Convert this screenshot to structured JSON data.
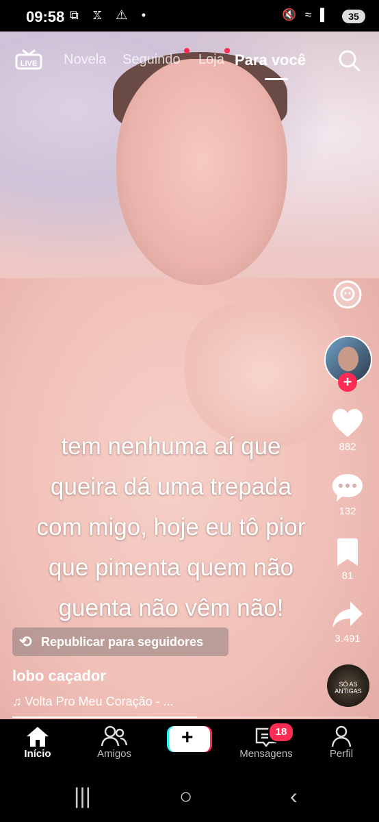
{
  "status_bar": {
    "time": "09:58",
    "left_icons": "⧉ 𝕏 ⚠ •",
    "right_icons": "🔇 ≈ ▌",
    "battery": "35"
  },
  "top_nav": {
    "live_label": "LIVE",
    "tabs": [
      {
        "label": "Novela"
      },
      {
        "label": "Seguindo"
      },
      {
        "label": "Loja"
      },
      {
        "label": "Para você"
      }
    ]
  },
  "caption": {
    "lines": [
      "tem nenhuma aí que",
      "queira dá uma trepada",
      "com migo, hoje eu tô pior",
      "que pimenta quem não",
      "guenta não vêm não!"
    ]
  },
  "rail": {
    "likes": "882",
    "comments": "132",
    "saves": "81",
    "shares": "3.491",
    "plus_symbol": "+",
    "disc_text": "SÓ AS ANTIGAS"
  },
  "repost": {
    "label": "Republicar para seguidores"
  },
  "video": {
    "author": "lobo caçador",
    "music": "♫ Volta Pro Meu Coração - ...",
    "progress": 0.52
  },
  "bottom_nav": {
    "items": [
      {
        "label": "Início"
      },
      {
        "label": "Amigos"
      },
      {
        "label": "Mensagens"
      },
      {
        "label": "Perfil"
      }
    ],
    "messages_badge": "18",
    "plus_symbol": "+"
  },
  "android_nav": {
    "recents": "|||",
    "home": "○",
    "back": "‹"
  },
  "colors": {
    "accent": "#fe2c55",
    "cyan": "#25f4ee"
  }
}
